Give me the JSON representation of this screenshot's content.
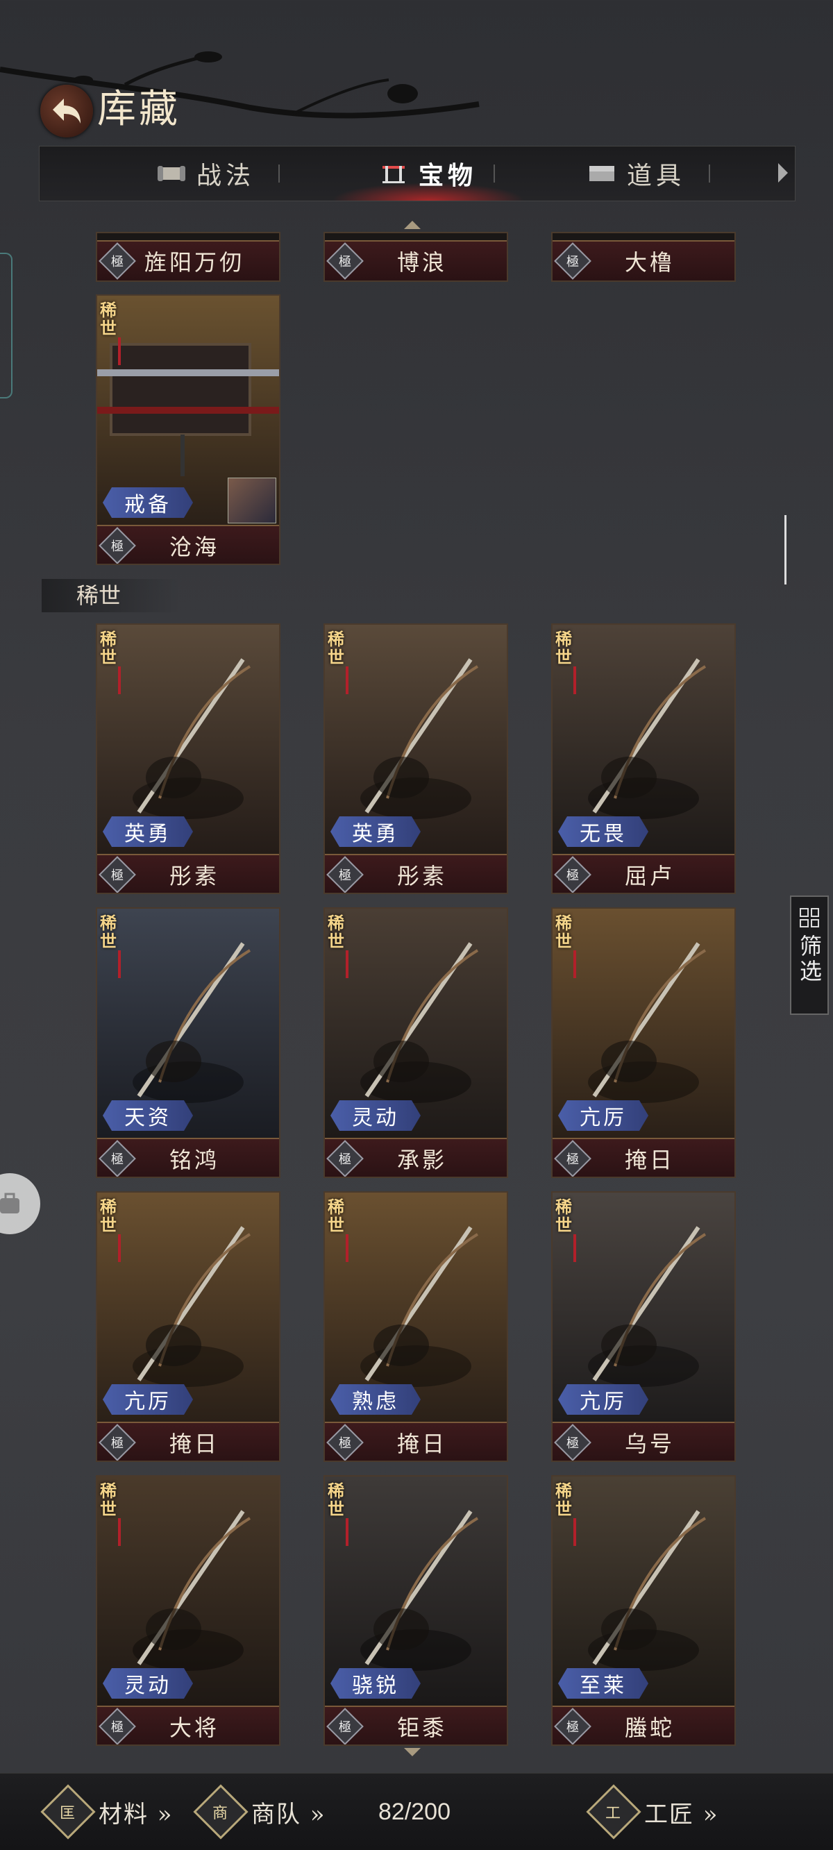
{
  "header": {
    "title": "库藏"
  },
  "tabs": [
    {
      "label": "战法",
      "icon": "scroll-icon",
      "active": false
    },
    {
      "label": "宝物",
      "icon": "weapon-rack-icon",
      "active": true
    },
    {
      "label": "道具",
      "icon": "chest-icon",
      "active": false
    }
  ],
  "grade_glyph": "極",
  "top_partial_row": [
    {
      "name": "旌阳万仞"
    },
    {
      "name": "博浪"
    },
    {
      "name": "大橹"
    }
  ],
  "featured_card": {
    "rarity": "稀世",
    "trait": "戒备",
    "name": "沧海"
  },
  "section_label": "稀世",
  "grid": [
    {
      "rarity": "稀世",
      "trait": "英勇",
      "name": "彤素"
    },
    {
      "rarity": "稀世",
      "trait": "英勇",
      "name": "彤素"
    },
    {
      "rarity": "稀世",
      "trait": "无畏",
      "name": "屈卢"
    },
    {
      "rarity": "稀世",
      "trait": "天资",
      "name": "铭鸿"
    },
    {
      "rarity": "稀世",
      "trait": "灵动",
      "name": "承影"
    },
    {
      "rarity": "稀世",
      "trait": "亢厉",
      "name": "掩日"
    },
    {
      "rarity": "稀世",
      "trait": "亢厉",
      "name": "掩日"
    },
    {
      "rarity": "稀世",
      "trait": "熟虑",
      "name": "掩日"
    },
    {
      "rarity": "稀世",
      "trait": "亢厉",
      "name": "乌号"
    },
    {
      "rarity": "稀世",
      "trait": "灵动",
      "name": "大将"
    },
    {
      "rarity": "稀世",
      "trait": "骁锐",
      "name": "钜黍"
    },
    {
      "rarity": "稀世",
      "trait": "至莱",
      "name": "螣蛇"
    }
  ],
  "filter": {
    "label": "筛选"
  },
  "bottom_bar": {
    "materials": {
      "label": "材料 »",
      "glyph": "匡"
    },
    "caravan": {
      "label": "商队 »",
      "glyph": "商"
    },
    "count": "82/200",
    "craftsman": {
      "label": "工匠 »",
      "glyph": "工"
    }
  }
}
